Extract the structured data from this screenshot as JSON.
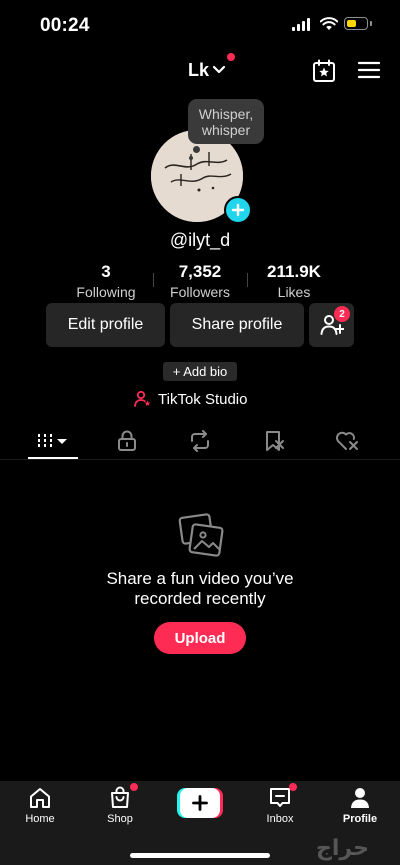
{
  "status_bar": {
    "time": "00:24",
    "battery_level": 0.55
  },
  "header": {
    "username": "Lk",
    "icons": [
      "star-calendar-icon",
      "menu-icon"
    ]
  },
  "avatar": {
    "caption_line1": "عبارك",
    "caption_line2": "مبارك جسور الفرح"
  },
  "tooltip": {
    "line1": "Whisper,",
    "line2": "whisper"
  },
  "profile": {
    "handle": "@ilyt_d"
  },
  "stats": [
    {
      "value": "3",
      "label": "Following"
    },
    {
      "value": "7,352",
      "label": "Followers"
    },
    {
      "value": "211.9K",
      "label": "Likes"
    }
  ],
  "buttons": {
    "edit": "Edit profile",
    "share": "Share profile",
    "friend_badge": "2"
  },
  "add_bio": "+ Add bio",
  "studio": "TikTok Studio",
  "tabs": [
    "videos-grid-icon",
    "lock-icon",
    "repost-icon",
    "favorites-icon",
    "liked-icon"
  ],
  "empty_state": {
    "title_line1": "Share a fun video you’ve",
    "title_line2": "recorded recently",
    "button": "Upload"
  },
  "nav": {
    "home": "Home",
    "shop": "Shop",
    "inbox": "Inbox",
    "profile": "Profile"
  },
  "watermark": "حراج",
  "colors": {
    "accent": "#fe2c55",
    "cyan": "#20d5ec",
    "background": "#000000"
  }
}
